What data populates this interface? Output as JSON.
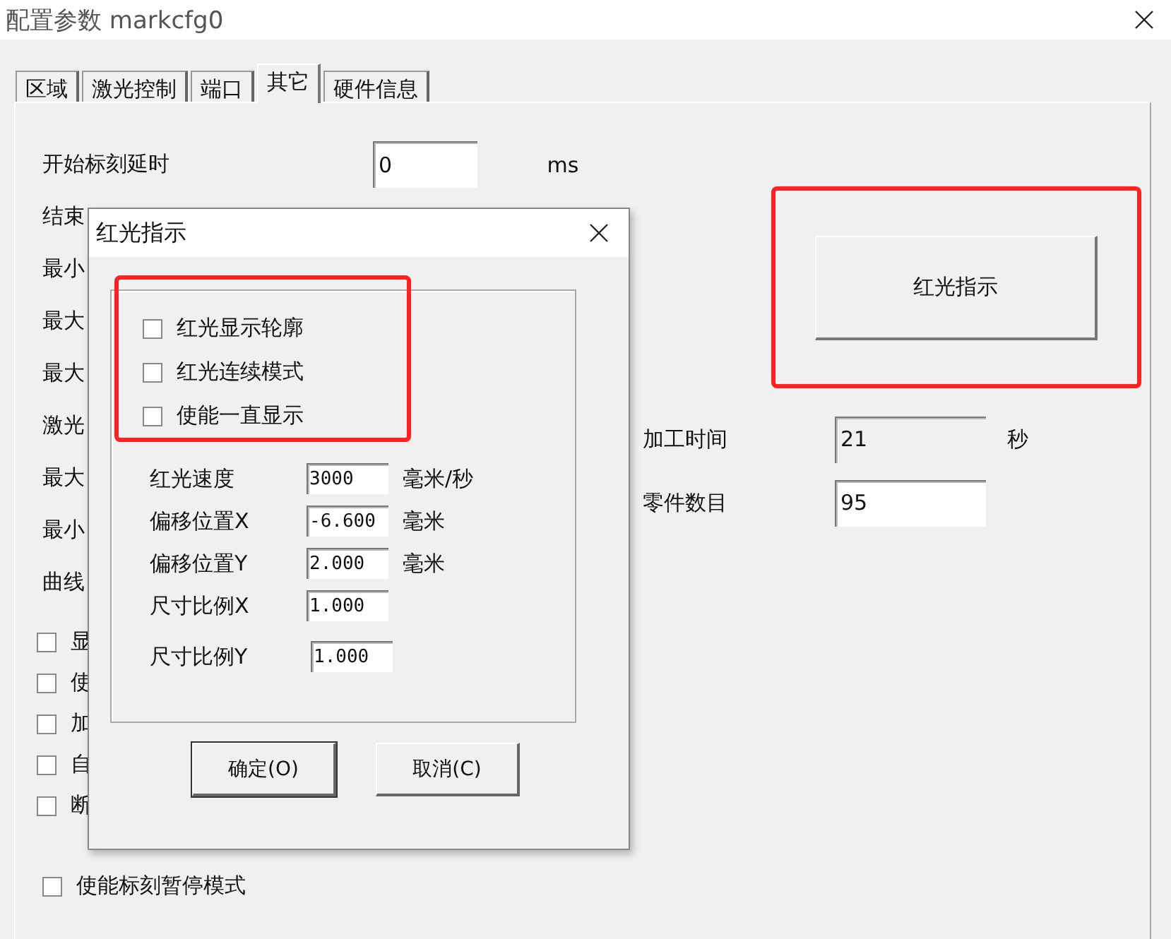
{
  "window": {
    "title": "配置参数 markcfg0"
  },
  "tabs": [
    {
      "label": "区域",
      "selected": false
    },
    {
      "label": "激光控制",
      "selected": false
    },
    {
      "label": "端口",
      "selected": false
    },
    {
      "label": "其它",
      "selected": true
    },
    {
      "label": "硬件信息",
      "selected": false
    }
  ],
  "form": {
    "rows": [
      {
        "label": "开始标刻延时",
        "value": "0",
        "unit": "ms"
      },
      {
        "label": "结束"
      },
      {
        "label": "最小"
      },
      {
        "label": "最大"
      },
      {
        "label": "最大"
      },
      {
        "label": "激光"
      },
      {
        "label": "最大"
      },
      {
        "label": "最小"
      },
      {
        "label": "曲线"
      }
    ],
    "checkboxes": [
      {
        "label": "显",
        "checked": false
      },
      {
        "label": "使",
        "checked": false
      },
      {
        "label": "加",
        "checked": false
      },
      {
        "label": "自",
        "checked": false
      },
      {
        "label": "断",
        "checked": false
      }
    ],
    "pause_checkbox": {
      "label": "使能标刻暂停模式",
      "checked": false
    }
  },
  "red_light_button": "红光指示",
  "stats": [
    {
      "label": "加工时间",
      "value": "21",
      "unit": "秒",
      "disabled": true
    },
    {
      "label": "零件数目",
      "value": "95",
      "disabled": false
    }
  ],
  "dialog": {
    "title": "红光指示",
    "checkboxes": [
      {
        "label": "红光显示轮廓",
        "checked": false
      },
      {
        "label": "红光连续模式",
        "checked": false
      },
      {
        "label": "使能一直显示",
        "checked": false
      }
    ],
    "fields": [
      {
        "label": "红光速度",
        "value": "3000",
        "unit": "毫米/秒"
      },
      {
        "label": "偏移位置X",
        "value": "-6.600",
        "unit": "毫米"
      },
      {
        "label": "偏移位置Y",
        "value": "2.000",
        "unit": "毫米"
      },
      {
        "label": "尺寸比例X",
        "value": "1.000"
      },
      {
        "label": "尺寸比例Y",
        "value": "1.000"
      }
    ],
    "buttons": [
      "确定(O)",
      "取消(C)"
    ]
  }
}
